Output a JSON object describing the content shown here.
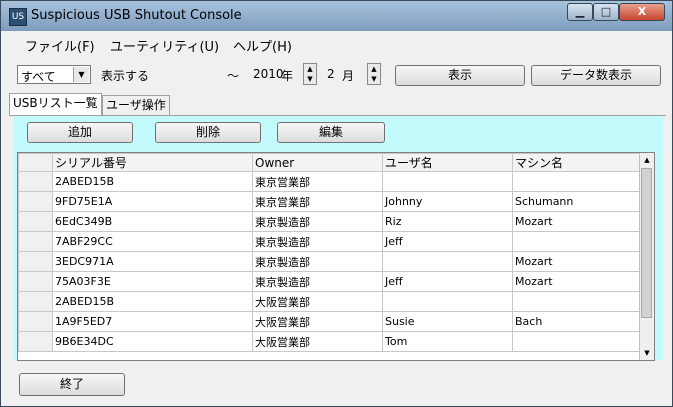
{
  "window": {
    "title": "Suspicious USB Shutout Console",
    "close_glyph": "X"
  },
  "menu": [
    "ファイル(F)",
    "ユーティリティ(U)",
    "ヘルプ(H)"
  ],
  "toolbar": {
    "filter_value": "すべて",
    "display_label": "表示する",
    "tilde": "～",
    "year": "2010",
    "year_unit": "年",
    "month": "2",
    "month_unit": "月",
    "show_button": "表示",
    "count_button": "データ数表示"
  },
  "tabs": [
    "USBリスト一覧",
    "ユーザ操作"
  ],
  "actions": {
    "add": "追加",
    "delete": "削除",
    "edit": "編集"
  },
  "table": {
    "headers": [
      "シリアル番号",
      "Owner",
      "ユーザ名",
      "マシン名"
    ],
    "rows": [
      [
        "2ABED15B",
        "東京営業部",
        "",
        ""
      ],
      [
        "9FD75E1A",
        "東京営業部",
        "Johnny",
        "Schumann"
      ],
      [
        "6EdC349B",
        "東京製造部",
        "Riz",
        "Mozart"
      ],
      [
        "7ABF29CC",
        "東京製造部",
        "Jeff",
        ""
      ],
      [
        "3EDC971A",
        "東京製造部",
        "",
        "Mozart"
      ],
      [
        "75A03F3E",
        "東京製造部",
        "Jeff",
        "Mozart"
      ],
      [
        "2ABED15B",
        "大阪営業部",
        "",
        ""
      ],
      [
        "1A9F5ED7",
        "大阪営業部",
        "Susie",
        "Bach"
      ],
      [
        "9B6E34DC",
        "大阪営業部",
        "Tom",
        ""
      ]
    ]
  },
  "footer": {
    "exit_button": "終了"
  }
}
